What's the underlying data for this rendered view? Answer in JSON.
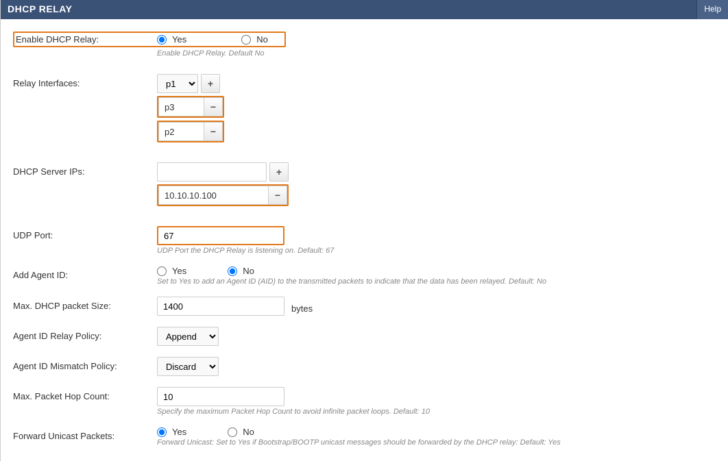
{
  "header": {
    "title": "DHCP RELAY",
    "help": "Help"
  },
  "fields": {
    "enable": {
      "label": "Enable DHCP Relay:",
      "yes": "Yes",
      "no": "No",
      "hint": "Enable DHCP Relay. Default No"
    },
    "relay_if": {
      "label": "Relay Interfaces:",
      "select_value": "p1",
      "items": [
        "p3",
        "p2"
      ]
    },
    "server_ips": {
      "label": "DHCP Server IPs:",
      "input_value": "",
      "items": [
        "10.10.10.100"
      ]
    },
    "udp_port": {
      "label": "UDP Port:",
      "value": "67",
      "hint": "UDP Port the DHCP Relay is listening on. Default: 67"
    },
    "agent_id": {
      "label": "Add Agent ID:",
      "yes": "Yes",
      "no": "No",
      "hint": "Set to Yes to add an Agent ID (AID) to the transmitted packets to indicate that the data has been relayed. Default: No"
    },
    "packet_size": {
      "label": "Max. DHCP packet Size:",
      "value": "1400",
      "unit": "bytes"
    },
    "relay_policy": {
      "label": "Agent ID Relay Policy:",
      "value": "Append"
    },
    "mismatch_policy": {
      "label": "Agent ID Mismatch Policy:",
      "value": "Discard"
    },
    "hop_count": {
      "label": "Max. Packet Hop Count:",
      "value": "10",
      "hint": "Specify the maximum Packet Hop Count to avoid infinite packet loops. Default: 10"
    },
    "fwd_unicast": {
      "label": "Forward Unicast Packets:",
      "yes": "Yes",
      "no": "No",
      "hint": "Forward Unicast: Set to Yes if Bootstrap/BOOTP unicast messages should be forwarded by the DHCP relay: Default: Yes"
    }
  }
}
